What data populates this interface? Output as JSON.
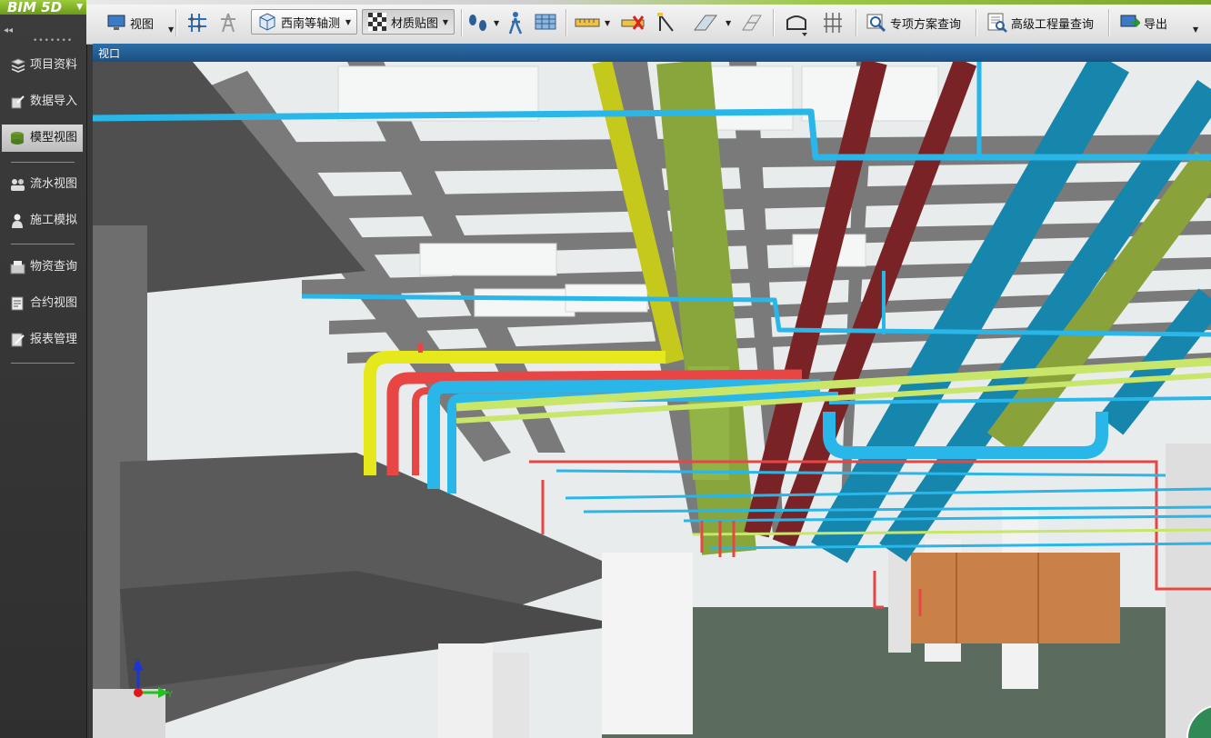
{
  "app": {
    "logo_text": "BIM 5D"
  },
  "sidebar": {
    "collapse_glyph": "◂◂",
    "grip_glyph": "•••••••",
    "items": [
      {
        "label": "项目资料",
        "icon": "stack-icon"
      },
      {
        "label": "数据导入",
        "icon": "import-icon"
      },
      {
        "label": "模型视图",
        "icon": "model-icon",
        "active": true
      },
      {
        "label": "流水视图",
        "icon": "flow-icon"
      },
      {
        "label": "施工模拟",
        "icon": "worker-icon"
      },
      {
        "label": "物资查询",
        "icon": "material-icon"
      },
      {
        "label": "合约视图",
        "icon": "contract-icon"
      },
      {
        "label": "报表管理",
        "icon": "report-icon"
      }
    ]
  },
  "toolbar": {
    "view_label": "视图",
    "view_mode": "西南等轴测",
    "material_mode": "材质贴图",
    "special_query_label": "专项方案查询",
    "advanced_query_label": "高级工程量查询",
    "export_label": "导出"
  },
  "viewport": {
    "tab_label": "视口",
    "axis_labels": {
      "z": "Z",
      "y": "Y"
    }
  },
  "colors": {
    "accent": "#8dbb2e",
    "viewport_tab": "#2d6ea8",
    "pipe_cyan": "#29b6e8",
    "pipe_red": "#e84545",
    "pipe_yellow": "#e5e81a",
    "pipe_darkred": "#7a2327",
    "pipe_teal": "#1786ad",
    "pipe_olive": "#8aa23a",
    "pipe_green": "#7ea53a",
    "door_orange": "#c98147"
  }
}
